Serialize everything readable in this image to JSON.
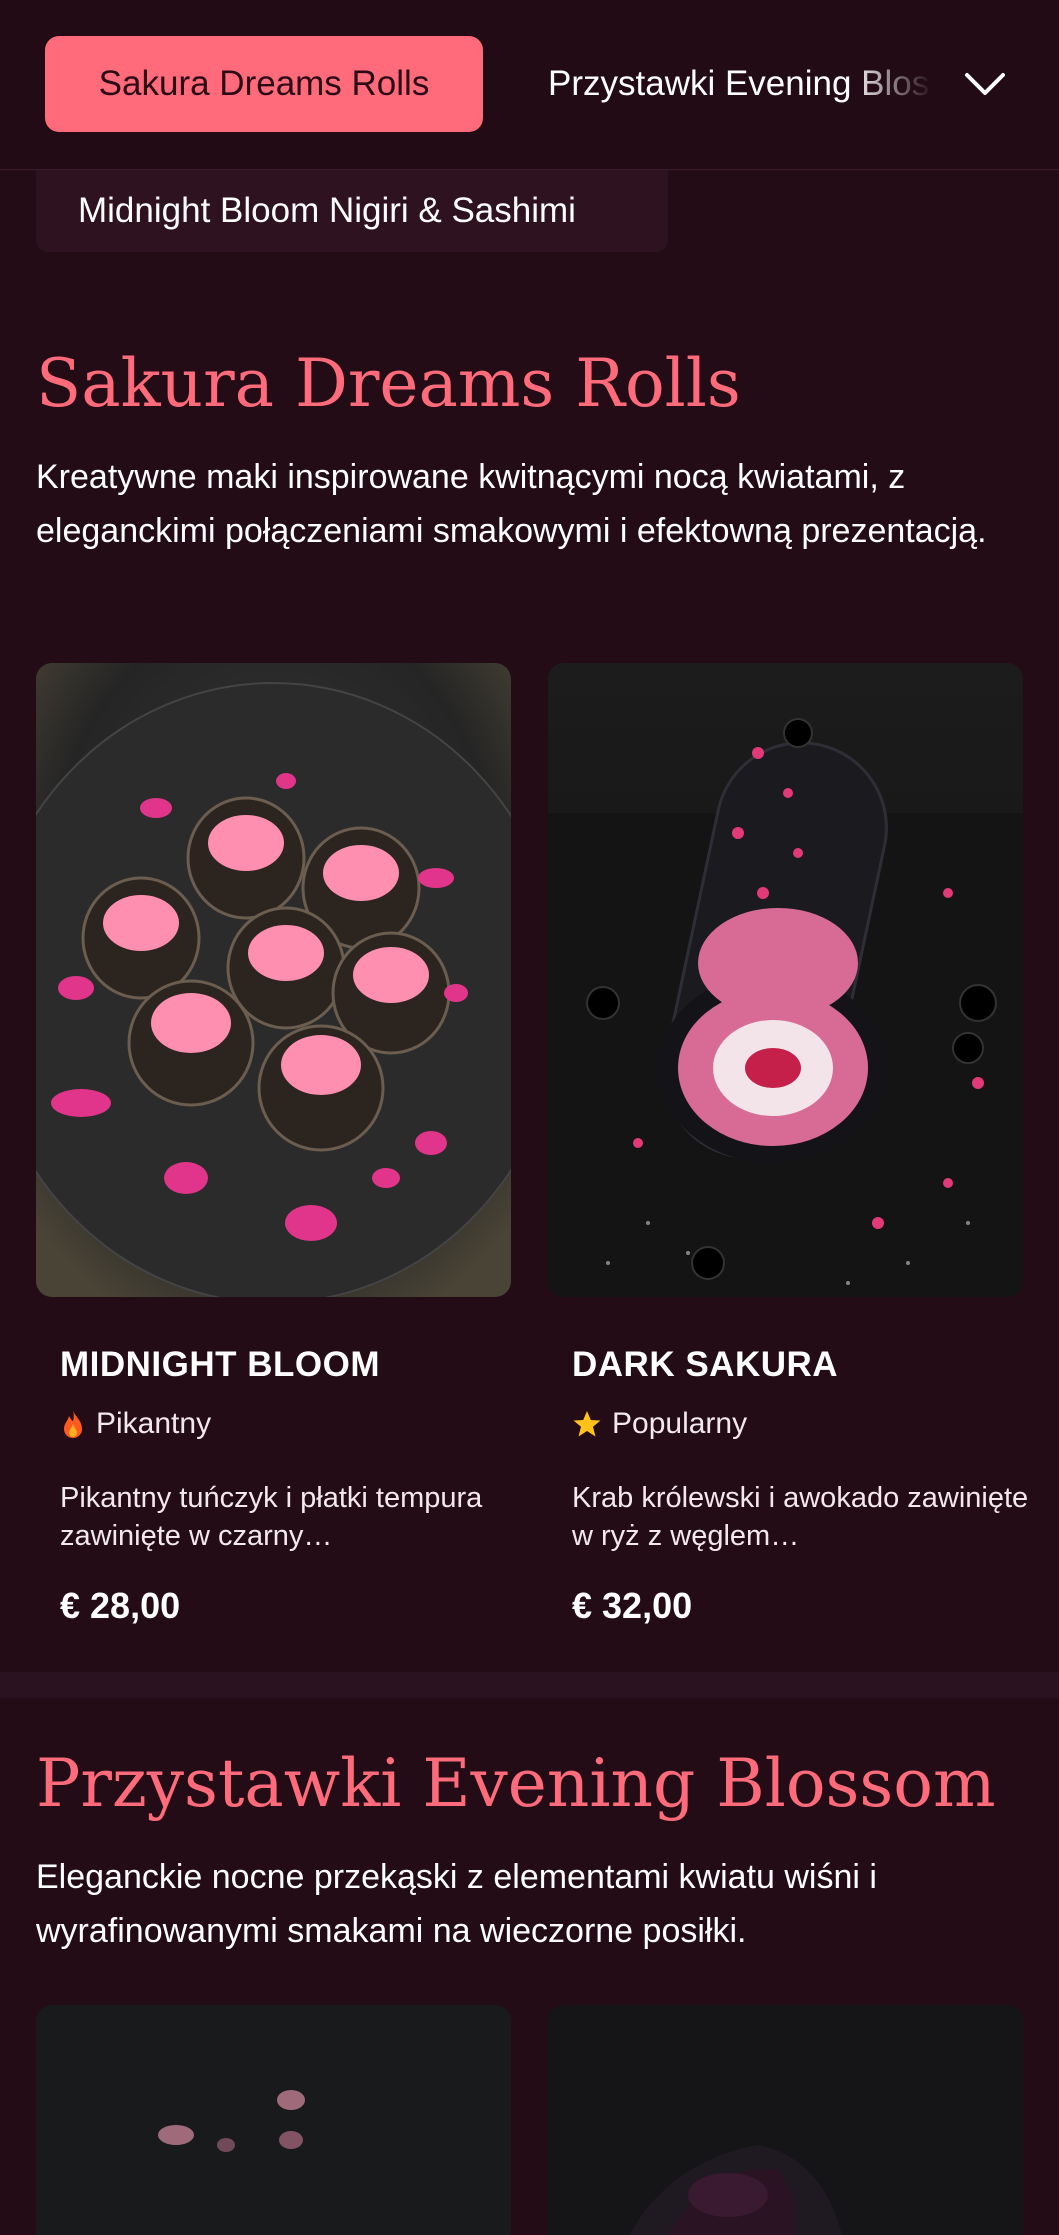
{
  "nav": {
    "active_tab": "Sakura Dreams Rolls",
    "next_tab": "Przystawki Evening Blossom",
    "second_row_tab": "Midnight Bloom Nigiri & Sashimi"
  },
  "sections": [
    {
      "title": "Sakura Dreams Rolls",
      "description": "Kreatywne maki inspirowane kwitnącymi nocą kwiatami, z eleganckimi połączeniami smakowymi i efektowną prezentacją.",
      "items": [
        {
          "name": "MIDNIGHT BLOOM",
          "badge": "Pikantny",
          "badge_icon": "flame-icon",
          "description": "Pikantny tuńczyk i płatki tempura zawinięte w czarny…",
          "price": "€ 28,00"
        },
        {
          "name": "DARK SAKURA",
          "badge": "Popularny",
          "badge_icon": "star-icon",
          "description": "Krab królewski i awokado zawinięte w ryż z węglem…",
          "price": "€ 32,00"
        }
      ]
    },
    {
      "title": "Przystawki Evening Blossom",
      "description": "Eleganckie nocne przekąski z elementami kwiatu wiśni i wyrafinowanymi smakami na wieczorne posiłki."
    }
  ],
  "colors": {
    "background": "#230c16",
    "accent": "#ff6b7a",
    "text": "#ffffff"
  }
}
